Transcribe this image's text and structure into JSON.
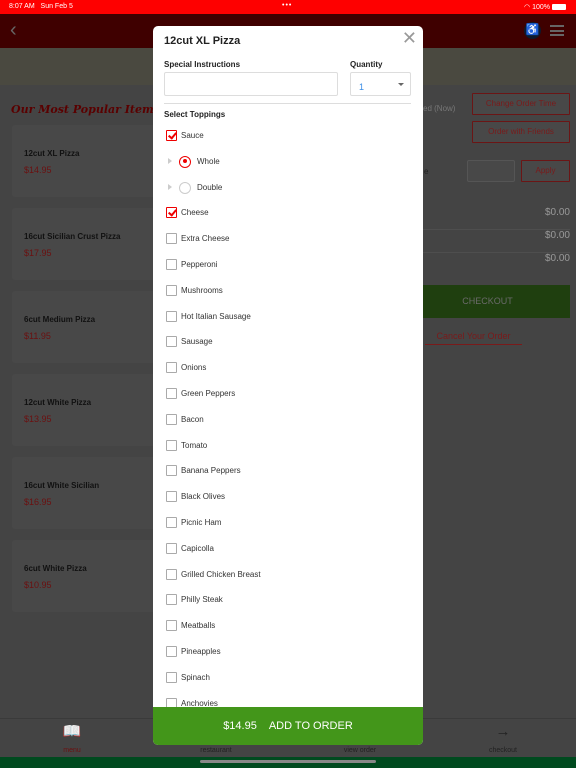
{
  "status_bar": {
    "time": "8:07 AM",
    "date": "Sun Feb 5",
    "battery": "100%"
  },
  "background": {
    "popular_title": "Our Most Popular Items",
    "items": [
      {
        "name": "12cut XL Pizza",
        "price": "$14.95"
      },
      {
        "name": "16cut Sicilian Crust Pizza",
        "price": "$17.95"
      },
      {
        "name": "6cut Medium Pizza",
        "price": "$11.95"
      },
      {
        "name": "12cut White Pizza",
        "price": "$13.95"
      },
      {
        "name": "16cut White Sicilian",
        "price": "$16.95"
      },
      {
        "name": "6cut White Pizza",
        "price": "$10.95"
      }
    ],
    "order_time_text": "ed (Now)",
    "change_order_time": "Change Order Time",
    "order_with_friends": "Order with Friends",
    "coupon_label_fragment": "e",
    "apply": "Apply",
    "totals": [
      "$0.00",
      "$0.00",
      "$0.00"
    ],
    "checkout": "CHECKOUT",
    "cancel": "Cancel Your Order",
    "nav": [
      {
        "label": "menu",
        "icon": "menu-book-icon"
      },
      {
        "label": "restaurant",
        "icon": "restaurant-icon"
      },
      {
        "label": "view order",
        "icon": "cart-icon"
      },
      {
        "label": "checkout",
        "icon": "arrow-right-icon"
      }
    ]
  },
  "modal": {
    "title": "12cut XL Pizza",
    "special_label": "Special Instructions",
    "special_value": "",
    "quantity_label": "Quantity",
    "quantity_value": "1",
    "toppings_label": "Select Toppings",
    "toppings": [
      {
        "label": "Sauce",
        "type": "checkbox",
        "checked": true
      },
      {
        "label": "Whole",
        "type": "radio",
        "checked": true
      },
      {
        "label": "Double",
        "type": "radio",
        "checked": false
      },
      {
        "label": "Cheese",
        "type": "checkbox",
        "checked": true
      },
      {
        "label": "Extra Cheese",
        "type": "checkbox",
        "checked": false
      },
      {
        "label": "Pepperoni",
        "type": "checkbox",
        "checked": false
      },
      {
        "label": "Mushrooms",
        "type": "checkbox",
        "checked": false
      },
      {
        "label": "Hot Italian Sausage",
        "type": "checkbox",
        "checked": false
      },
      {
        "label": "Sausage",
        "type": "checkbox",
        "checked": false
      },
      {
        "label": "Onions",
        "type": "checkbox",
        "checked": false
      },
      {
        "label": "Green Peppers",
        "type": "checkbox",
        "checked": false
      },
      {
        "label": "Bacon",
        "type": "checkbox",
        "checked": false
      },
      {
        "label": "Tomato",
        "type": "checkbox",
        "checked": false
      },
      {
        "label": "Banana Peppers",
        "type": "checkbox",
        "checked": false
      },
      {
        "label": "Black Olives",
        "type": "checkbox",
        "checked": false
      },
      {
        "label": "Picnic Ham",
        "type": "checkbox",
        "checked": false
      },
      {
        "label": "Capicolla",
        "type": "checkbox",
        "checked": false
      },
      {
        "label": "Grilled Chicken Breast",
        "type": "checkbox",
        "checked": false
      },
      {
        "label": "Philly Steak",
        "type": "checkbox",
        "checked": false
      },
      {
        "label": "Meatballs",
        "type": "checkbox",
        "checked": false
      },
      {
        "label": "Pineapples",
        "type": "checkbox",
        "checked": false
      },
      {
        "label": "Spinach",
        "type": "checkbox",
        "checked": false
      },
      {
        "label": "Anchovies",
        "type": "checkbox",
        "checked": false
      }
    ],
    "add_price": "$14.95",
    "add_label": "ADD TO ORDER"
  },
  "colors": {
    "accent": "#e00000",
    "add_button": "#43961a"
  }
}
